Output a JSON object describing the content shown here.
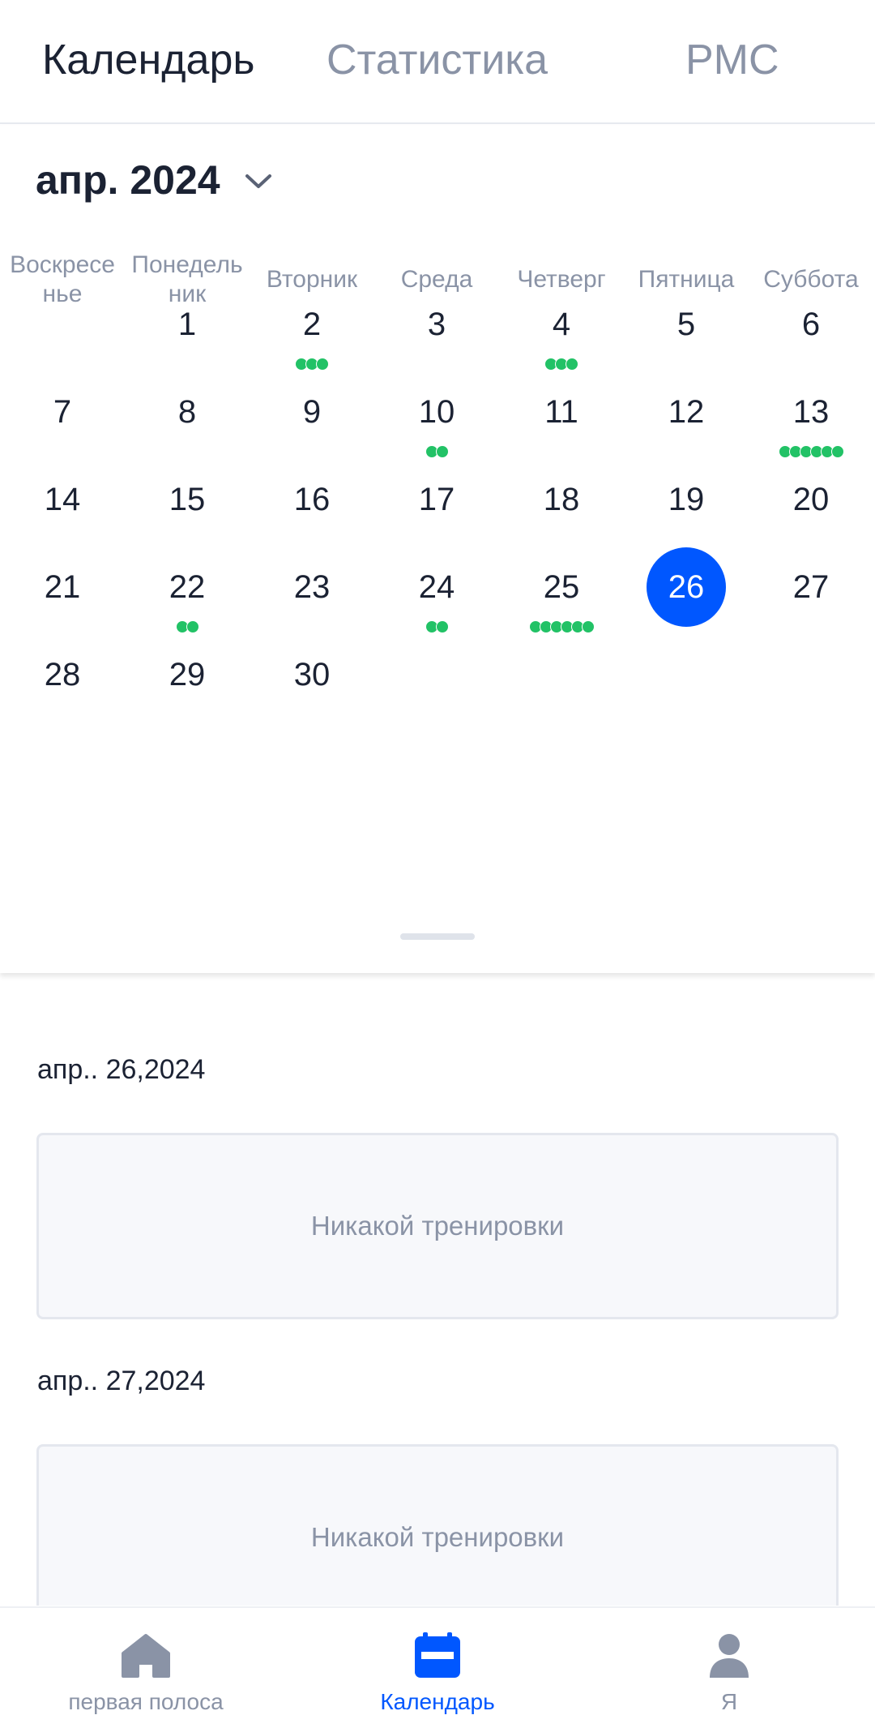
{
  "top_tabs": [
    {
      "label": "Календарь",
      "active": true
    },
    {
      "label": "Статистика",
      "active": false
    },
    {
      "label": "PMC",
      "active": false
    }
  ],
  "calendar": {
    "month_label": "апр. 2024",
    "weekdays": [
      "Воскресенье",
      "Понедельник",
      "Вторник",
      "Среда",
      "Четверг",
      "Пятница",
      "Суббота"
    ],
    "weekday_display": [
      [
        "Воскресе",
        "нье"
      ],
      [
        "Понедель",
        "ник"
      ],
      [
        "Вторник"
      ],
      [
        "Среда"
      ],
      [
        "Четверг"
      ],
      [
        "Пятница"
      ],
      [
        "Суббота"
      ]
    ],
    "first_weekday_index": 1,
    "selected_day": "26",
    "days": [
      {
        "day": "1",
        "dots": 0
      },
      {
        "day": "2",
        "dots": 3
      },
      {
        "day": "3",
        "dots": 0
      },
      {
        "day": "4",
        "dots": 3
      },
      {
        "day": "5",
        "dots": 0
      },
      {
        "day": "6",
        "dots": 0
      },
      {
        "day": "7",
        "dots": 0
      },
      {
        "day": "8",
        "dots": 0
      },
      {
        "day": "9",
        "dots": 0
      },
      {
        "day": "10",
        "dots": 2
      },
      {
        "day": "11",
        "dots": 0
      },
      {
        "day": "12",
        "dots": 0
      },
      {
        "day": "13",
        "dots": 6
      },
      {
        "day": "14",
        "dots": 0
      },
      {
        "day": "15",
        "dots": 0
      },
      {
        "day": "16",
        "dots": 0
      },
      {
        "day": "17",
        "dots": 0
      },
      {
        "day": "18",
        "dots": 0
      },
      {
        "day": "19",
        "dots": 0
      },
      {
        "day": "20",
        "dots": 0
      },
      {
        "day": "21",
        "dots": 0
      },
      {
        "day": "22",
        "dots": 2
      },
      {
        "day": "23",
        "dots": 0
      },
      {
        "day": "24",
        "dots": 2
      },
      {
        "day": "25",
        "dots": 6
      },
      {
        "day": "26",
        "dots": 0
      },
      {
        "day": "27",
        "dots": 0
      },
      {
        "day": "28",
        "dots": 0
      },
      {
        "day": "29",
        "dots": 0
      },
      {
        "day": "30",
        "dots": 0
      }
    ],
    "dot_color": "#22c266",
    "selected_color": "#0057ff"
  },
  "workouts": [
    {
      "date": "апр.. 26,2024",
      "text": "Никакой тренировки"
    },
    {
      "date": "апр.. 27,2024",
      "text": "Никакой тренировки"
    }
  ],
  "bottom_nav": [
    {
      "label": "первая полоса",
      "icon": "home-icon",
      "active": false
    },
    {
      "label": "Календарь",
      "icon": "calendar-icon",
      "active": true
    },
    {
      "label": "Я",
      "icon": "profile-icon",
      "active": false
    }
  ],
  "colors": {
    "accent": "#0057ff",
    "muted": "#8a93a6",
    "text": "#1b2233"
  }
}
